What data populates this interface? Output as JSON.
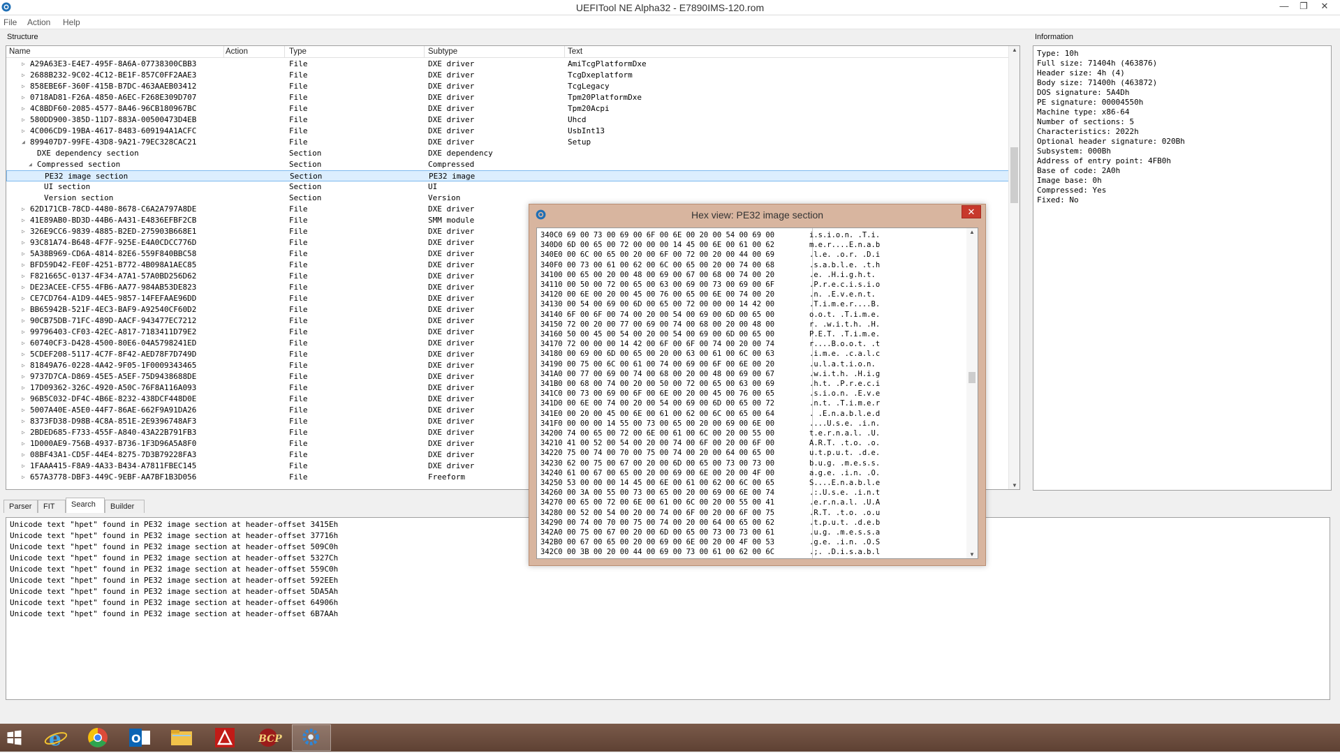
{
  "window": {
    "title": "UEFITool NE Alpha32 - E7890IMS-120.rom",
    "minimize": "—",
    "restore": "❐",
    "close": "✕"
  },
  "menu": [
    "File",
    "Action",
    "Help"
  ],
  "panels": {
    "structure": "Structure",
    "information": "Information"
  },
  "columns": [
    "Name",
    "Action",
    "Type",
    "Subtype",
    "Text"
  ],
  "tree": [
    {
      "name": "A29A63E3-E4E7-495F-8A6A-07738300CBB3",
      "type": "File",
      "subtype": "DXE driver",
      "text": "AmiTcgPlatformDxe",
      "level": 1,
      "exp": "▷"
    },
    {
      "name": "2688B232-9C02-4C12-BE1F-857C0FF2AAE3",
      "type": "File",
      "subtype": "DXE driver",
      "text": "TcgDxeplatform",
      "level": 1,
      "exp": "▷"
    },
    {
      "name": "858EBE6F-360F-415B-B7DC-463AAEB03412",
      "type": "File",
      "subtype": "DXE driver",
      "text": "TcgLegacy",
      "level": 1,
      "exp": "▷"
    },
    {
      "name": "0718AD81-F26A-4850-A6EC-F268E309D707",
      "type": "File",
      "subtype": "DXE driver",
      "text": "Tpm20PlatformDxe",
      "level": 1,
      "exp": "▷"
    },
    {
      "name": "4C8BDF60-2085-4577-8A46-96CB180967BC",
      "type": "File",
      "subtype": "DXE driver",
      "text": "Tpm20Acpi",
      "level": 1,
      "exp": "▷"
    },
    {
      "name": "580DD900-385D-11D7-883A-00500473D4EB",
      "type": "File",
      "subtype": "DXE driver",
      "text": "Uhcd",
      "level": 1,
      "exp": "▷"
    },
    {
      "name": "4C006CD9-19BA-4617-8483-609194A1ACFC",
      "type": "File",
      "subtype": "DXE driver",
      "text": "UsbInt13",
      "level": 1,
      "exp": "▷"
    },
    {
      "name": "899407D7-99FE-43D8-9A21-79EC328CAC21",
      "type": "File",
      "subtype": "DXE driver",
      "text": "Setup",
      "level": 1,
      "exp": "◢"
    },
    {
      "name": "DXE dependency section",
      "type": "Section",
      "subtype": "DXE dependency",
      "text": "",
      "level": 2,
      "exp": ""
    },
    {
      "name": "Compressed section",
      "type": "Section",
      "subtype": "Compressed",
      "text": "",
      "level": 2,
      "exp": "◢"
    },
    {
      "name": "PE32 image section",
      "type": "Section",
      "subtype": "PE32 image",
      "text": "",
      "level": 3,
      "exp": "",
      "sel": true
    },
    {
      "name": "UI section",
      "type": "Section",
      "subtype": "UI",
      "text": "",
      "level": 3,
      "exp": ""
    },
    {
      "name": "Version section",
      "type": "Section",
      "subtype": "Version",
      "text": "",
      "level": 3,
      "exp": ""
    },
    {
      "name": "62D171CB-78CD-4480-8678-C6A2A797A8DE",
      "type": "File",
      "subtype": "DXE driver",
      "text": "",
      "level": 1,
      "exp": "▷"
    },
    {
      "name": "41E89AB0-BD3D-44B6-A431-E4836EFBF2CB",
      "type": "File",
      "subtype": "SMM module",
      "text": "",
      "level": 1,
      "exp": "▷"
    },
    {
      "name": "326E9CC6-9839-4885-B2ED-275903B668E1",
      "type": "File",
      "subtype": "DXE driver",
      "text": "",
      "level": 1,
      "exp": "▷"
    },
    {
      "name": "93C81A74-B648-4F7F-925E-E4A0CDCC776D",
      "type": "File",
      "subtype": "DXE driver",
      "text": "",
      "level": 1,
      "exp": "▷"
    },
    {
      "name": "5A38B969-CD6A-4814-82E6-559F840BBC58",
      "type": "File",
      "subtype": "DXE driver",
      "text": "",
      "level": 1,
      "exp": "▷"
    },
    {
      "name": "BFD59D42-FE0F-4251-B772-4B098A1AEC85",
      "type": "File",
      "subtype": "DXE driver",
      "text": "",
      "level": 1,
      "exp": "▷"
    },
    {
      "name": "F821665C-0137-4F34-A7A1-57A0BD256D62",
      "type": "File",
      "subtype": "DXE driver",
      "text": "",
      "level": 1,
      "exp": "▷"
    },
    {
      "name": "DE23ACEE-CF55-4FB6-AA77-984AB53DE823",
      "type": "File",
      "subtype": "DXE driver",
      "text": "",
      "level": 1,
      "exp": "▷"
    },
    {
      "name": "CE7CD764-A1D9-44E5-9857-14FEFAAE96DD",
      "type": "File",
      "subtype": "DXE driver",
      "text": "",
      "level": 1,
      "exp": "▷"
    },
    {
      "name": "BB65942B-521F-4EC3-BAF9-A92540CF60D2",
      "type": "File",
      "subtype": "DXE driver",
      "text": "",
      "level": 1,
      "exp": "▷"
    },
    {
      "name": "90CB75DB-71FC-489D-AACF-943477EC7212",
      "type": "File",
      "subtype": "DXE driver",
      "text": "",
      "level": 1,
      "exp": "▷"
    },
    {
      "name": "99796403-CF03-42EC-A817-7183411D79E2",
      "type": "File",
      "subtype": "DXE driver",
      "text": "",
      "level": 1,
      "exp": "▷"
    },
    {
      "name": "60740CF3-D428-4500-80E6-04A5798241ED",
      "type": "File",
      "subtype": "DXE driver",
      "text": "",
      "level": 1,
      "exp": "▷"
    },
    {
      "name": "5CDEF208-5117-4C7F-8F42-AED78F7D749D",
      "type": "File",
      "subtype": "DXE driver",
      "text": "",
      "level": 1,
      "exp": "▷"
    },
    {
      "name": "81849A76-0228-4A42-9F05-1F0009343465",
      "type": "File",
      "subtype": "DXE driver",
      "text": "",
      "level": 1,
      "exp": "▷"
    },
    {
      "name": "9737D7CA-D869-45E5-A5EF-75D9438688DE",
      "type": "File",
      "subtype": "DXE driver",
      "text": "",
      "level": 1,
      "exp": "▷"
    },
    {
      "name": "17D09362-326C-4920-A50C-76F8A116A093",
      "type": "File",
      "subtype": "DXE driver",
      "text": "",
      "level": 1,
      "exp": "▷"
    },
    {
      "name": "96B5C032-DF4C-4B6E-8232-438DCF448D0E",
      "type": "File",
      "subtype": "DXE driver",
      "text": "",
      "level": 1,
      "exp": "▷"
    },
    {
      "name": "5007A40E-A5E0-44F7-86AE-662F9A91DA26",
      "type": "File",
      "subtype": "DXE driver",
      "text": "",
      "level": 1,
      "exp": "▷"
    },
    {
      "name": "8373FD38-D98B-4C8A-851E-2E9396748AF3",
      "type": "File",
      "subtype": "DXE driver",
      "text": "",
      "level": 1,
      "exp": "▷"
    },
    {
      "name": "2BDED685-F733-455F-A840-43A22B791FB3",
      "type": "File",
      "subtype": "DXE driver",
      "text": "",
      "level": 1,
      "exp": "▷"
    },
    {
      "name": "1D000AE9-756B-4937-B736-1F3D96A5A8F0",
      "type": "File",
      "subtype": "DXE driver",
      "text": "",
      "level": 1,
      "exp": "▷"
    },
    {
      "name": "08BF43A1-CD5F-44E4-8275-7D3B79228FA3",
      "type": "File",
      "subtype": "DXE driver",
      "text": "",
      "level": 1,
      "exp": "▷"
    },
    {
      "name": "1FAAA415-F8A9-4A33-B434-A7811FBEC145",
      "type": "File",
      "subtype": "DXE driver",
      "text": "",
      "level": 1,
      "exp": "▷"
    },
    {
      "name": "657A3778-DBF3-449C-9EBF-AA7BF1B3D056",
      "type": "File",
      "subtype": "Freeform",
      "text": "",
      "level": 1,
      "exp": "▷"
    }
  ],
  "info_lines": [
    "Type: 10h",
    "Full size: 71404h (463876)",
    "Header size: 4h (4)",
    "Body size: 71400h (463872)",
    "DOS signature: 5A4Dh",
    "PE signature: 00004550h",
    "Machine type: x86-64",
    "Number of sections: 5",
    "Characteristics: 2022h",
    "Optional header signature: 020Bh",
    "Subsystem: 000Bh",
    "Address of entry point: 4FB0h",
    "Base of code: 2A0h",
    "Image base: 0h",
    "Compressed: Yes",
    "Fixed: No"
  ],
  "tabs": [
    "Parser",
    "FIT",
    "Search",
    "Builder"
  ],
  "messages": [
    "Unicode text \"hpet\" found in PE32 image section at header-offset 3415Eh",
    "Unicode text \"hpet\" found in PE32 image section at header-offset 37716h",
    "Unicode text \"hpet\" found in PE32 image section at header-offset 509C0h",
    "Unicode text \"hpet\" found in PE32 image section at header-offset 5327Ch",
    "Unicode text \"hpet\" found in PE32 image section at header-offset 559C0h",
    "Unicode text \"hpet\" found in PE32 image section at header-offset 592EEh",
    "Unicode text \"hpet\" found in PE32 image section at header-offset 5DA5Ah",
    "Unicode text \"hpet\" found in PE32 image section at header-offset 64906h",
    "Unicode text \"hpet\" found in PE32 image section at header-offset 6B7AAh"
  ],
  "hexview": {
    "title": "Hex view: PE32 image section",
    "close": "✕",
    "rows": [
      {
        "hex": "340C0 69 00 73 00 69 00 6F 00 6E 00 20 00 54 00 69 00",
        "str": "i.s.i.o.n. .T.i."
      },
      {
        "hex": "340D0 6D 00 65 00 72 00 00 00 14 45 00 6E 00 61 00 62",
        "str": "m.e.r....E.n.a.b"
      },
      {
        "hex": "340E0 00 6C 00 65 00 20 00 6F 00 72 00 20 00 44 00 69",
        "str": ".l.e. .o.r. .D.i"
      },
      {
        "hex": "340F0 00 73 00 61 00 62 00 6C 00 65 00 20 00 74 00 68",
        "str": ".s.a.b.l.e. .t.h"
      },
      {
        "hex": "34100 00 65 00 20 00 48 00 69 00 67 00 68 00 74 00 20",
        "str": ".e. .H.i.g.h.t. "
      },
      {
        "hex": "34110 00 50 00 72 00 65 00 63 00 69 00 73 00 69 00 6F",
        "str": ".P.r.e.c.i.s.i.o"
      },
      {
        "hex": "34120 00 6E 00 20 00 45 00 76 00 65 00 6E 00 74 00 20",
        "str": ".n. .E.v.e.n.t. "
      },
      {
        "hex": "34130 00 54 00 69 00 6D 00 65 00 72 00 00 00 14 42 00",
        "str": ".T.i.m.e.r....B."
      },
      {
        "hex": "34140 6F 00 6F 00 74 00 20 00 54 00 69 00 6D 00 65 00",
        "str": "o.o.t. .T.i.m.e."
      },
      {
        "hex": "34150 72 00 20 00 77 00 69 00 74 00 68 00 20 00 48 00",
        "str": "r. .w.i.t.h. .H."
      },
      {
        "hex": "34160 50 00 45 00 54 00 20 00 54 00 69 00 6D 00 65 00",
        "str": "P.E.T. .T.i.m.e."
      },
      {
        "hex": "34170 72 00 00 00 14 42 00 6F 00 6F 00 74 00 20 00 74",
        "str": "r....B.o.o.t. .t"
      },
      {
        "hex": "34180 00 69 00 6D 00 65 00 20 00 63 00 61 00 6C 00 63",
        "str": ".i.m.e. .c.a.l.c"
      },
      {
        "hex": "34190 00 75 00 6C 00 61 00 74 00 69 00 6F 00 6E 00 20",
        "str": ".u.l.a.t.i.o.n. "
      },
      {
        "hex": "341A0 00 77 00 69 00 74 00 68 00 20 00 48 00 69 00 67",
        "str": ".w.i.t.h. .H.i.g"
      },
      {
        "hex": "341B0 00 68 00 74 00 20 00 50 00 72 00 65 00 63 00 69",
        "str": ".h.t. .P.r.e.c.i"
      },
      {
        "hex": "341C0 00 73 00 69 00 6F 00 6E 00 20 00 45 00 76 00 65",
        "str": ".s.i.o.n. .E.v.e"
      },
      {
        "hex": "341D0 00 6E 00 74 00 20 00 54 00 69 00 6D 00 65 00 72",
        "str": ".n.t. .T.i.m.e.r"
      },
      {
        "hex": "341E0 00 20 00 45 00 6E 00 61 00 62 00 6C 00 65 00 64",
        "str": ". .E.n.a.b.l.e.d"
      },
      {
        "hex": "341F0 00 00 00 14 55 00 73 00 65 00 20 00 69 00 6E 00",
        "str": "....U.s.e. .i.n."
      },
      {
        "hex": "34200 74 00 65 00 72 00 6E 00 61 00 6C 00 20 00 55 00",
        "str": "t.e.r.n.a.l. .U."
      },
      {
        "hex": "34210 41 00 52 00 54 00 20 00 74 00 6F 00 20 00 6F 00",
        "str": "A.R.T. .t.o. .o."
      },
      {
        "hex": "34220 75 00 74 00 70 00 75 00 74 00 20 00 64 00 65 00",
        "str": "u.t.p.u.t. .d.e."
      },
      {
        "hex": "34230 62 00 75 00 67 00 20 00 6D 00 65 00 73 00 73 00",
        "str": "b.u.g. .m.e.s.s."
      },
      {
        "hex": "34240 61 00 67 00 65 00 20 00 69 00 6E 00 20 00 4F 00",
        "str": "a.g.e. .i.n. .O."
      },
      {
        "hex": "34250 53 00 00 00 14 45 00 6E 00 61 00 62 00 6C 00 65",
        "str": "S....E.n.a.b.l.e"
      },
      {
        "hex": "34260 00 3A 00 55 00 73 00 65 00 20 00 69 00 6E 00 74",
        "str": ".:.U.s.e. .i.n.t"
      },
      {
        "hex": "34270 00 65 00 72 00 6E 00 61 00 6C 00 20 00 55 00 41",
        "str": ".e.r.n.a.l. .U.A"
      },
      {
        "hex": "34280 00 52 00 54 00 20 00 74 00 6F 00 20 00 6F 00 75",
        "str": ".R.T. .t.o. .o.u"
      },
      {
        "hex": "34290 00 74 00 70 00 75 00 74 00 20 00 64 00 65 00 62",
        "str": ".t.p.u.t. .d.e.b"
      },
      {
        "hex": "342A0 00 75 00 67 00 20 00 6D 00 65 00 73 00 73 00 61",
        "str": ".u.g. .m.e.s.s.a"
      },
      {
        "hex": "342B0 00 67 00 65 00 20 00 69 00 6E 00 20 00 4F 00 53",
        "str": ".g.e. .i.n. .O.S"
      },
      {
        "hex": "342C0 00 3B 00 20 00 44 00 69 00 73 00 61 00 62 00 6C",
        "str": ".;. .D.i.s.a.b.l"
      }
    ]
  },
  "taskbar": [
    "windows-start-icon",
    "internet-explorer-icon",
    "chrome-icon",
    "outlook-icon",
    "file-explorer-icon",
    "acrobat-icon",
    "bcp-app-icon",
    "uefitool-taskbar-icon"
  ]
}
